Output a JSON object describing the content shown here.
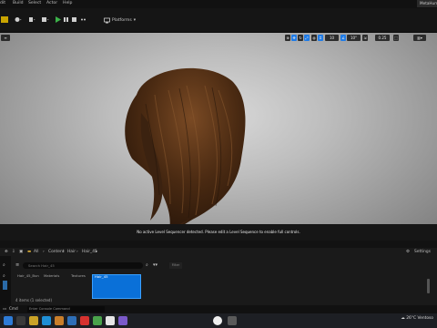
{
  "menu": {
    "items": [
      "dit",
      "Build",
      "Select",
      "Actor",
      "Help"
    ],
    "project_tab": "MetaHum"
  },
  "toolbar": {
    "platforms_label": "Platforms"
  },
  "viewport": {
    "toolbar": {
      "camera_speed": "0.25",
      "fov_value": "10"
    },
    "sequencer_message": "No active Level Sequencer detected. Please edit a Level Sequence to enable full controls."
  },
  "content_browser": {
    "breadcrumbs": [
      "All",
      "Content",
      "Hair",
      "Hair_45"
    ],
    "settings_label": "Settings",
    "search_placeholder": "Search Hair_45",
    "filter_label": "Filter",
    "assets": [
      "Hair_45_Bun",
      "Materials",
      "Textures",
      "Hair_45"
    ],
    "items_count": "4 items (1 selected)"
  },
  "statusbar": {
    "cmd_label": "Cmd",
    "cmd_placeholder": "Enter Console Command"
  },
  "taskbar": {
    "temperature": "26°C",
    "weather": "Ventoso"
  },
  "colors": {
    "accent_blue": "#0a70d8",
    "play_green": "#3cb34a",
    "hair_brown": "#4a2a12"
  }
}
